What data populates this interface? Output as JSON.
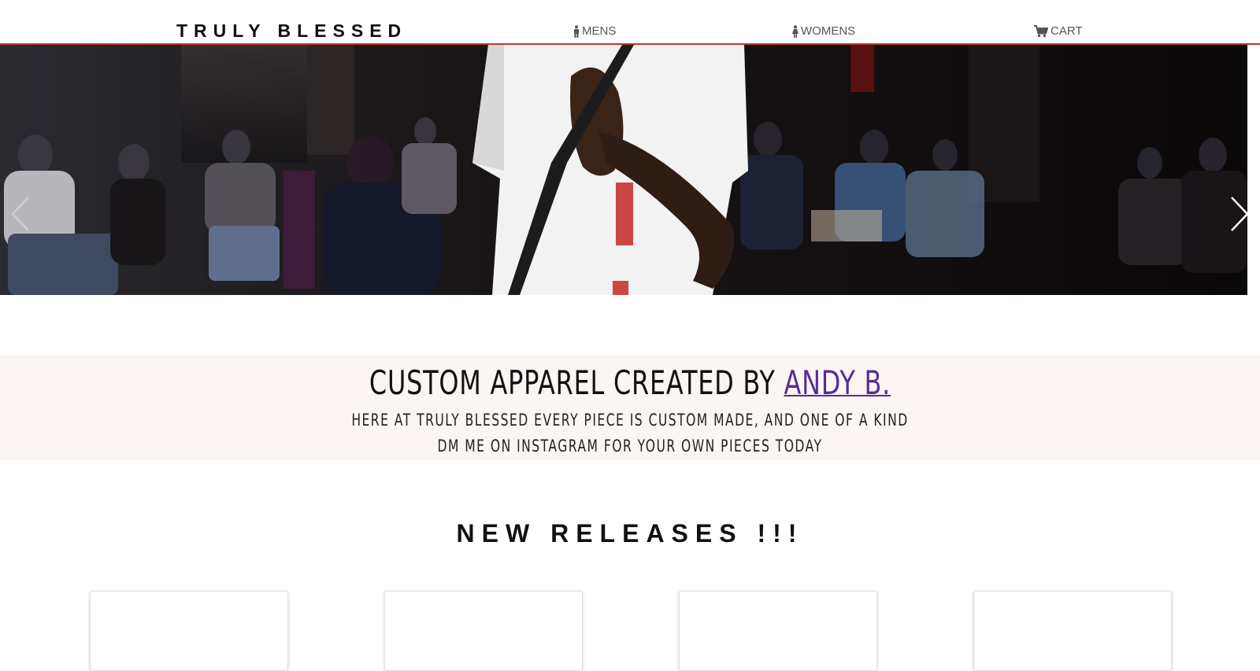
{
  "navbar": {
    "brand": "TRULY BLESSED",
    "links": [
      {
        "label": "MENS",
        "icon": "male-icon"
      },
      {
        "label": "WOMENS",
        "icon": "female-icon"
      },
      {
        "label": "CART",
        "icon": "cart-icon"
      }
    ],
    "accent_color": "#c0392b"
  },
  "carousel": {
    "prev_icon": "chevron-left-icon",
    "next_icon": "chevron-right-icon"
  },
  "tagline": {
    "heading_prefix": "CUSTOM APPAREL CREATED BY",
    "heading_link": "ANDY B.",
    "link_color": "#5b2c91",
    "line1": "HERE AT TRULY BLESSED EVERY PIECE IS CUSTOM MADE, AND ONE OF A KIND",
    "line2": "DM ME ON INSTAGRAM FOR YOUR OWN PIECES TODAY"
  },
  "releases": {
    "title": "NEW RELEASES !!!"
  }
}
